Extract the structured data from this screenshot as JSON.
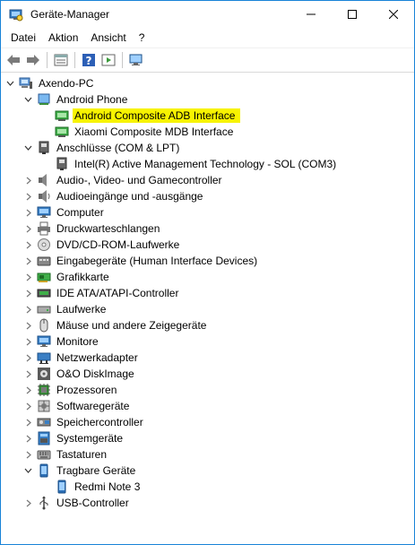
{
  "window": {
    "title": "Geräte-Manager"
  },
  "menu": [
    "Datei",
    "Aktion",
    "Ansicht",
    "?"
  ],
  "tree": {
    "root": "Axendo-PC",
    "android_phone": {
      "label": "Android Phone",
      "children": [
        "Android Composite ADB Interface",
        "Xiaomi Composite MDB Interface"
      ]
    },
    "ports": {
      "label": "Anschlüsse (COM & LPT)",
      "children": [
        "Intel(R) Active Management Technology - SOL (COM3)"
      ]
    },
    "categories": [
      "Audio-, Video- und Gamecontroller",
      "Audioeingänge und -ausgänge",
      "Computer",
      "Druckwarteschlangen",
      "DVD/CD-ROM-Laufwerke",
      "Eingabegeräte (Human Interface Devices)",
      "Grafikkarte",
      "IDE ATA/ATAPI-Controller",
      "Laufwerke",
      "Mäuse und andere Zeigegeräte",
      "Monitore",
      "Netzwerkadapter",
      "O&O DiskImage",
      "Prozessoren",
      "Softwaregeräte",
      "Speichercontroller",
      "Systemgeräte",
      "Tastaturen"
    ],
    "portable": {
      "label": "Tragbare Geräte",
      "children": [
        "Redmi Note 3"
      ]
    },
    "usb": "USB-Controller"
  },
  "colors": {
    "highlight": "#f7f300",
    "title_border": "#1883d7"
  }
}
